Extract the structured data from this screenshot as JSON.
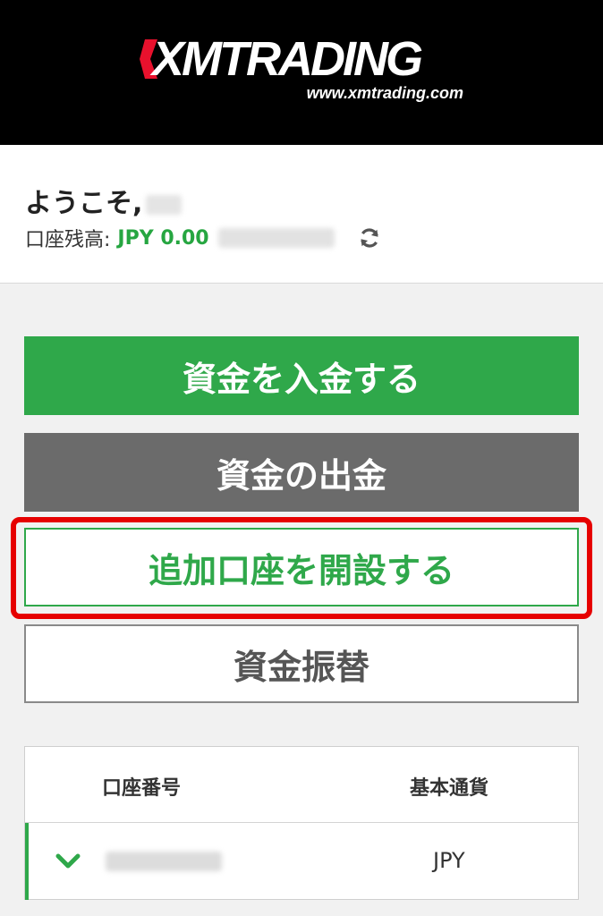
{
  "header": {
    "logo_text": "XMTRADING",
    "logo_url": "www.xmtrading.com"
  },
  "welcome": {
    "greeting": "ようこそ,",
    "balance_label": "口座残高:",
    "balance_amount": "JPY 0.00"
  },
  "actions": {
    "deposit": "資金を入金する",
    "withdraw": "資金の出金",
    "open_account": "追加口座を開設する",
    "transfer": "資金振替"
  },
  "accounts_table": {
    "columns": [
      "口座番号",
      "基本通貨"
    ],
    "rows": [
      {
        "currency": "JPY"
      }
    ]
  },
  "colors": {
    "brand_green": "#2fa84a",
    "withdraw_gray": "#6b6b6b",
    "highlight_red": "#e60000",
    "header_black": "#000000"
  },
  "icons": [
    "xm-logo-mark-icon",
    "refresh-icon",
    "chevron-down-icon"
  ]
}
